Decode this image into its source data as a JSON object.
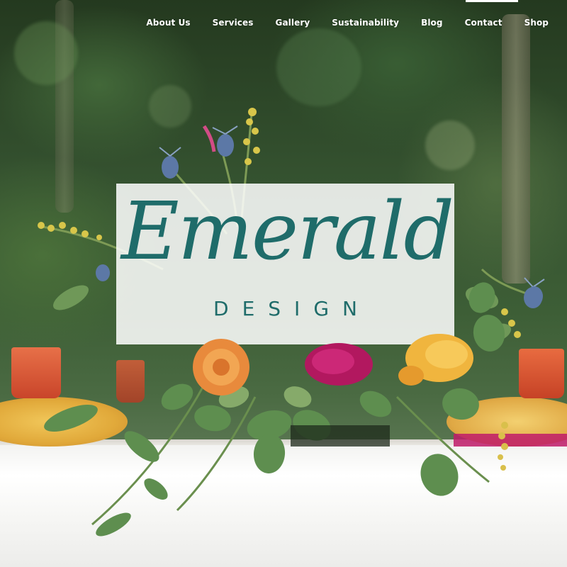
{
  "nav": {
    "items": [
      {
        "label": "About Us"
      },
      {
        "label": "Services"
      },
      {
        "label": "Gallery"
      },
      {
        "label": "Sustainability"
      },
      {
        "label": "Blog"
      },
      {
        "label": "Contact"
      },
      {
        "label": "Shop"
      }
    ]
  },
  "logo": {
    "script": "Emerald",
    "subtitle": "DESIGN"
  },
  "colors": {
    "brand_teal": "#1f6c6a",
    "nav_text": "#ffffff"
  }
}
